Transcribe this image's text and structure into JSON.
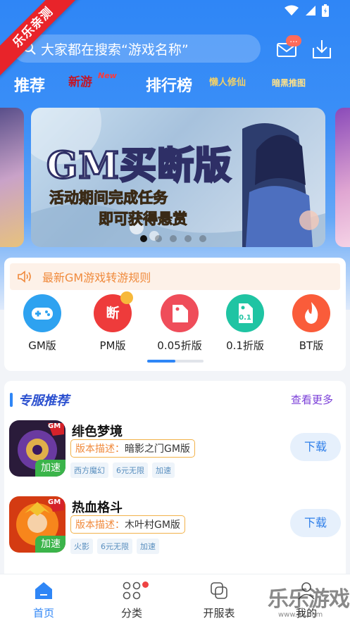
{
  "colors": {
    "primary": "#2f86f6",
    "ribbon": "#e8242a",
    "notice": "#f08a3c",
    "speed": "#3bb44a",
    "accent_more": "#7b3fd8"
  },
  "ribbon": {
    "text": "乐乐亲测"
  },
  "search": {
    "placeholder": "大家都在搜索“游戏名称”"
  },
  "mail": {
    "badge": "..."
  },
  "nav": {
    "recommend": "推荐",
    "xinyou": "新游",
    "xinyou_new": "New",
    "ranking": "排行榜",
    "lanren": "懒人修仙",
    "anhei": "暗黑推图"
  },
  "banner": {
    "title": "GM买断版",
    "line1": "活动期间完成任务",
    "line2": "即可获得悬赏",
    "dots": 5,
    "active_dot": 0
  },
  "notice": {
    "text": "最新GM游戏转游规则"
  },
  "categories": [
    {
      "label": "GM版",
      "icon": "gamepad-icon"
    },
    {
      "label": "PM版",
      "icon": "pm-icon",
      "glyph": "断"
    },
    {
      "label": "0.05折版",
      "icon": "tag-icon"
    },
    {
      "label": "0.1折版",
      "icon": "discount-tag-icon",
      "glyph": "0.1"
    },
    {
      "label": "BT版",
      "icon": "flame-icon"
    }
  ],
  "section": {
    "title": "专服推荐",
    "more": "查看更多"
  },
  "games": [
    {
      "name": "绯色梦境",
      "desc_key": "版本描述：",
      "desc_val": "暗影之门GM版",
      "tags": [
        "西方魔幻",
        "6元无限",
        "加速"
      ],
      "speed": "加速",
      "badge": "GM",
      "download": "下载"
    },
    {
      "name": "热血格斗",
      "desc_key": "版本描述：",
      "desc_val": "木叶村GM版",
      "tags": [
        "火影",
        "6元无限",
        "加速"
      ],
      "speed": "加速",
      "badge": "GM",
      "download": "下载"
    }
  ],
  "tabs": [
    {
      "label": "首页",
      "icon": "home-icon",
      "active": true
    },
    {
      "label": "分类",
      "icon": "grid-icon",
      "dot": true
    },
    {
      "label": "开服表",
      "icon": "server-list-icon"
    },
    {
      "label": "我的",
      "icon": "profile-icon"
    }
  ],
  "watermark": {
    "text": "乐乐游戏",
    "url": "www.6ll.com"
  }
}
